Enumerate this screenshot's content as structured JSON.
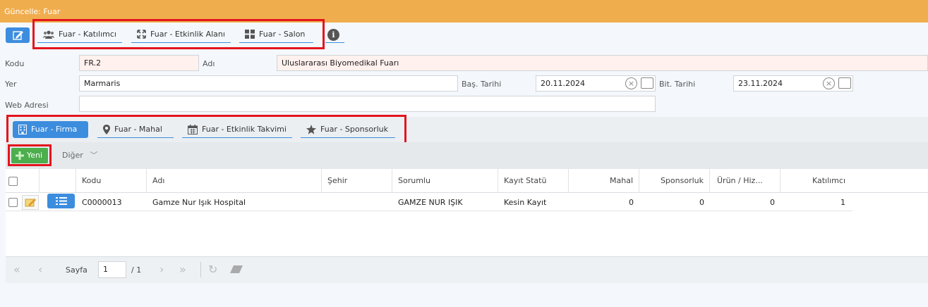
{
  "window": {
    "title": "Güncelle: Fuar"
  },
  "top_tabs": [
    {
      "label": "Fuar - Katılımcı",
      "icon": "users-icon"
    },
    {
      "label": "Fuar - Etkinlik Alanı",
      "icon": "expand-icon"
    },
    {
      "label": "Fuar - Salon",
      "icon": "grid-icon"
    }
  ],
  "form": {
    "kodu_label": "Kodu",
    "kodu_value": "FR.2",
    "adi_label": "Adı",
    "adi_value": "Uluslararası Biyomedikal Fuarı",
    "yer_label": "Yer",
    "yer_value": "Marmaris",
    "bas_label": "Baş. Tarihi",
    "bas_value": "20.11.2024",
    "bit_label": "Bit. Tarihi",
    "bit_value": "23.11.2024",
    "web_label": "Web Adresi",
    "web_value": ""
  },
  "sub_tabs": [
    {
      "label": "Fuar - Firma",
      "icon": "building-icon",
      "active": true
    },
    {
      "label": "Fuar - Mahal",
      "icon": "map-pin-icon"
    },
    {
      "label": "Fuar - Etkinlik Takvimi",
      "icon": "calendar-icon"
    },
    {
      "label": "Fuar - Sponsorluk",
      "icon": "star-icon"
    }
  ],
  "toolbar": {
    "new_label": "Yeni",
    "more_label": "Diğer"
  },
  "grid": {
    "headers": [
      "Kodu",
      "Adı",
      "Şehir",
      "Sorumlu",
      "Kayıt Statü",
      "Mahal",
      "Sponsorluk",
      "Ürün / Hiz...",
      "Katılımcı"
    ],
    "rows": [
      [
        "C0000013",
        "Gamze Nur Işık Hospital",
        "",
        "GAMZE NUR IŞIK",
        "Kesin Kayıt",
        "0",
        "0",
        "0",
        "1"
      ]
    ]
  },
  "pager": {
    "page_label": "Sayfa",
    "page_value": "1",
    "total": "/ 1"
  },
  "colors": {
    "title_bar": "#f0ad4e",
    "accent": "#3c8dde",
    "new_button": "#4cae4c",
    "highlight": "#e3141d"
  }
}
